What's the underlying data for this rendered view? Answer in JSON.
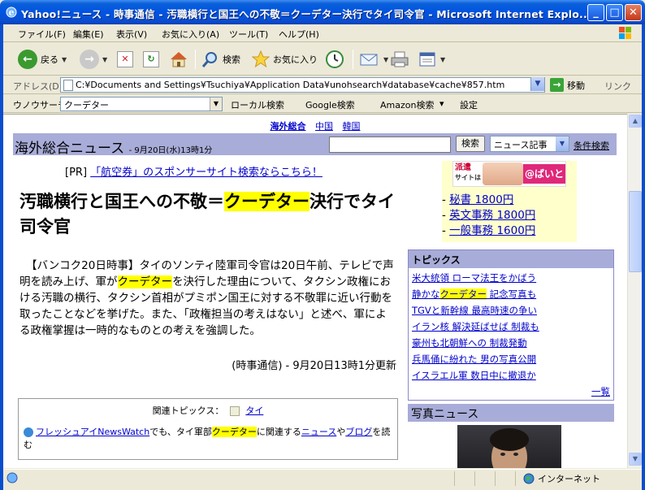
{
  "window": {
    "title": "Yahoo!ニュース - 時事通信 - 汚職横行と国王への不敬＝クーデター決行でタイ司令官 - Microsoft Internet Explo..."
  },
  "menu": {
    "items": [
      "ファイル(F)",
      "編集(E)",
      "表示(V)",
      "お気に入り(A)",
      "ツール(T)",
      "ヘルプ(H)"
    ]
  },
  "toolbar": {
    "back_label": "戻る",
    "search_label": "検索",
    "favorites_label": "お気に入り"
  },
  "address": {
    "label": "アドレス(D)",
    "value": "C:¥Documents and Settings¥Tsuchiya¥Application Data¥unohsearch¥database¥cache¥857.htm",
    "go_label": "移動",
    "links_label": "リンク"
  },
  "search_toolbar": {
    "label": "ウノウサーチ",
    "query": "クーデター",
    "items": [
      "ローカル検索",
      "Google検索",
      "Amazon検索",
      "設定"
    ]
  },
  "page": {
    "top_links": [
      "海外総合",
      "中国",
      "韓国"
    ],
    "header_title": "海外総合ニュース",
    "header_date": "- 9月20日(水)13時1分",
    "search_button": "検索",
    "search_select": "ニュース記事",
    "advanced_search": "条件検索",
    "pr_label": "[PR]",
    "pr_link": "「航空券」のスポンサーサイト検索ならこちら！",
    "headline": {
      "pre": "汚職横行と国王への不敬＝",
      "highlight": "クーデター",
      "post": "決行でタイ司令官"
    },
    "body": {
      "p1": "【バンコク20日時事】タイのソンティ陸軍司令官は20日午前、テレビで声明を読み上げ、軍が",
      "highlight": "クーデター",
      "p2": "を決行した理由について、タクシン政権における汚職の横行、タクシン首相がプミポン国王に対する不敬罪に近い行動を取ったことなどを挙げた。また、「政権担当の考えはない」と述べ、軍による政権掌握は一時的なものとの考えを強調した。"
    },
    "source": "(時事通信) - 9月20日13時1分更新",
    "related": {
      "label": "関連トピックス：",
      "topic": "タイ",
      "link1": "フレッシュアイNewsWatch",
      "text1": "でも、タイ軍部",
      "highlight": "クーデター",
      "text2": "に関連する",
      "link2": "ニュース",
      "text3": "や",
      "link3": "ブログ",
      "text4": "を読む"
    }
  },
  "ad": {
    "banner_text1": "派遣",
    "banner_text2": "サイトは",
    "banner_brand": "@ばいと",
    "links": [
      "秘書 1800円",
      "英文事務 1800円",
      "一般事務 1600円"
    ]
  },
  "topics": {
    "title": "トピックス",
    "items": [
      {
        "text": "米大統領 ローマ法王をかばう"
      },
      {
        "pre": "静かな",
        "highlight": "クーデター",
        "post": " 記念写真も"
      },
      {
        "text": "TGVと新幹線 最高時速の争い"
      },
      {
        "text": "イラン核 解決延ばせば 制裁も"
      },
      {
        "text": "豪州も北朝鮮への 制裁発動"
      },
      {
        "text": "兵馬俑に紛れた 男の写真公開"
      },
      {
        "text": "イスラエル軍 数日中に撤退か"
      }
    ],
    "more": "一覧"
  },
  "photo_news": {
    "title": "写真ニュース"
  },
  "status": {
    "zone": "インターネット"
  },
  "colors": {
    "highlight": "#ffff00",
    "header_bg": "#a8acd8",
    "link": "#0000cc",
    "titlebar": "#0054e3"
  }
}
